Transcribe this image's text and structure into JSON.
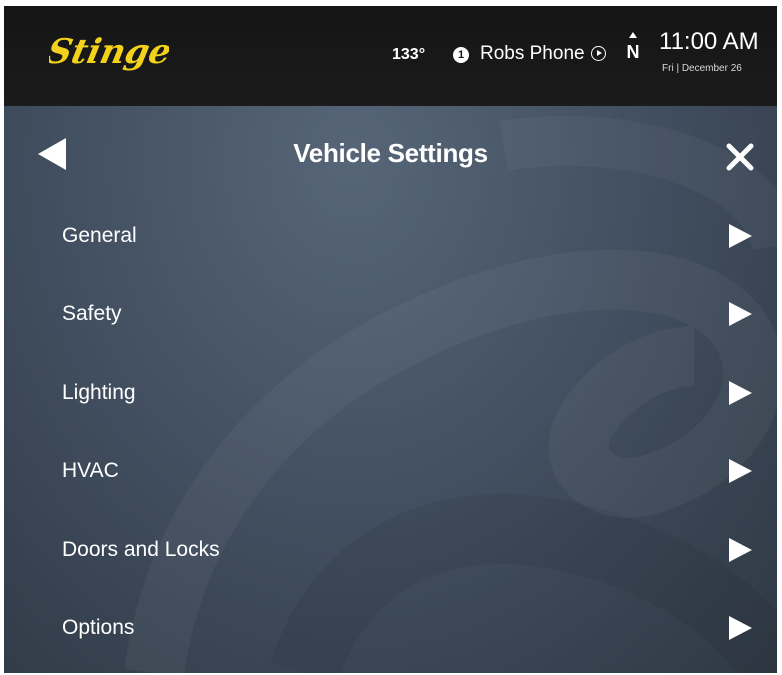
{
  "status_bar": {
    "brand": "Stinger",
    "temperature": "133°",
    "phone_badge": "1",
    "phone_name": "Robs Phone",
    "compass_heading": "N",
    "time": "11:00 AM",
    "date": "Fri | December 26",
    "colors": {
      "brand_yellow": "#f2d21a",
      "bar_background": "#151515"
    }
  },
  "header": {
    "title": "Vehicle Settings",
    "back_icon": "back-arrow-icon",
    "close_icon": "close-icon"
  },
  "menu": {
    "items": [
      {
        "label": "General",
        "icon": "chevron-right-icon"
      },
      {
        "label": "Safety",
        "icon": "chevron-right-icon"
      },
      {
        "label": "Lighting",
        "icon": "chevron-right-icon"
      },
      {
        "label": "HVAC",
        "icon": "chevron-right-icon"
      },
      {
        "label": "Doors and Locks",
        "icon": "chevron-right-icon"
      },
      {
        "label": "Options",
        "icon": "chevron-right-icon"
      }
    ]
  }
}
